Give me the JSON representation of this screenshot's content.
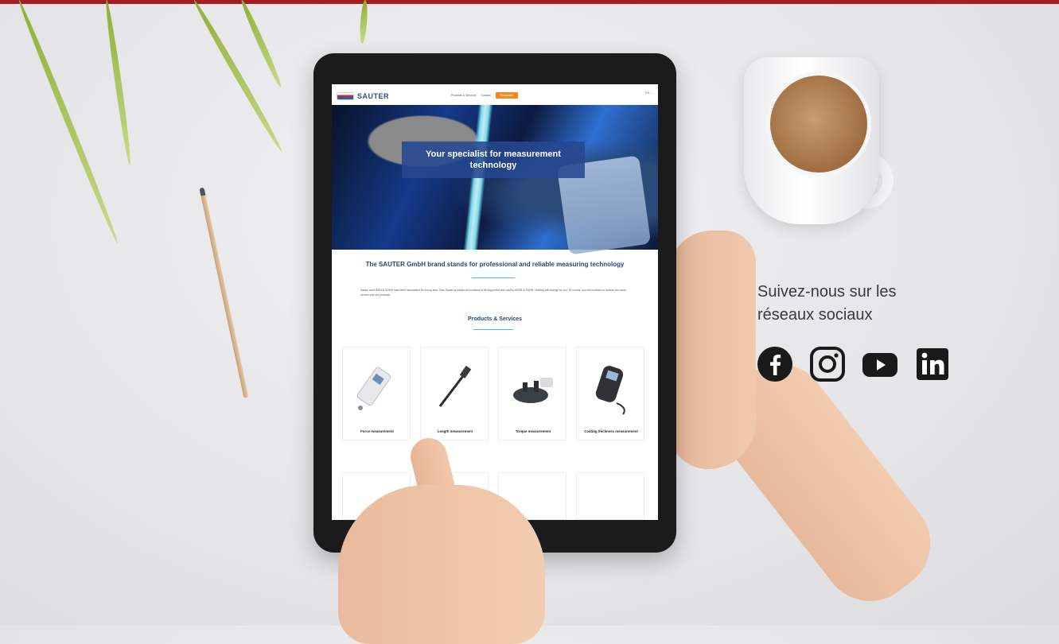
{
  "colors": {
    "topbar": "#a51d24",
    "brand_blue": "#27457e",
    "accent_teal": "#3ec3cf",
    "cta_orange": "#f08a1c"
  },
  "tablet_site": {
    "logo_text": "SAUTER",
    "nav": {
      "links": [
        "Products & Services",
        "Contact"
      ],
      "cta_label": "Newsletter",
      "language": "EN ⌄"
    },
    "hero_title": "Your specialist for measurement technology",
    "brand_title": "The SAUTER GmbH brand stands for professional and reliable measuring technology",
    "intro_text": "Sauter and KERN & SOHN have been associated for a long time. Now Sauter products will continue to be supported and sold by KERN & SOHN. Nothing will change for you. Of course, you will continue to receive the usual service and our products.",
    "section_title": "Products & Services",
    "products": [
      {
        "label": "Force measurement",
        "icon": "force-gauge-icon"
      },
      {
        "label": "Length measurement",
        "icon": "length-probe-icon"
      },
      {
        "label": "Torque measurement",
        "icon": "torque-tester-icon"
      },
      {
        "label": "Coating thickness measurement",
        "icon": "coating-gauge-icon"
      }
    ]
  },
  "social": {
    "heading": "Suivez-nous sur les réseaux sociaux",
    "icons": [
      "facebook-icon",
      "instagram-icon",
      "youtube-icon",
      "linkedin-icon"
    ]
  }
}
